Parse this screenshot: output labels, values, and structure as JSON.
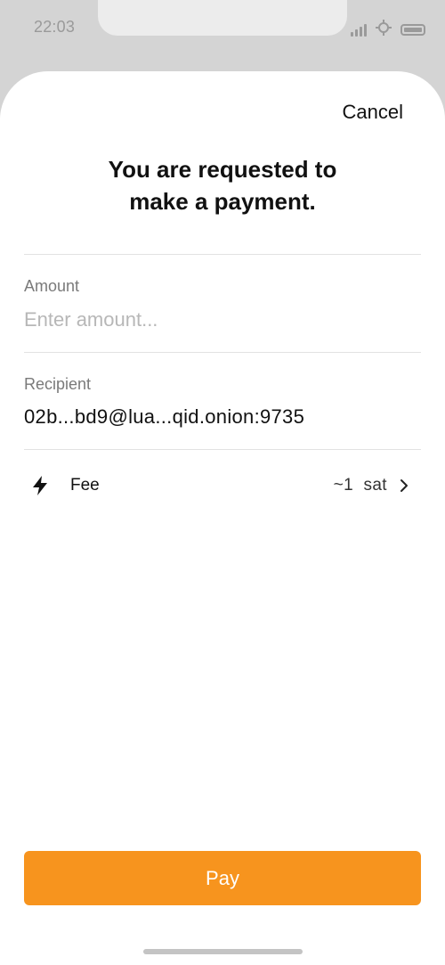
{
  "status_bar": {
    "time": "22:03"
  },
  "header": {
    "cancel_label": "Cancel",
    "title_line1": "You are requested to",
    "title_line2": "make a payment."
  },
  "amount": {
    "label": "Amount",
    "placeholder": "Enter amount...",
    "value": ""
  },
  "recipient": {
    "label": "Recipient",
    "value": "02b...bd9@lua...qid.onion:9735"
  },
  "fee": {
    "icon": "lightning-bolt-icon",
    "label": "Fee",
    "value": "~1  sat"
  },
  "pay_button": {
    "label": "Pay"
  },
  "colors": {
    "accent": "#f7941e",
    "chrome": "#d4d4d4",
    "muted_text": "#7a7a7a",
    "placeholder": "#b7b7b7"
  }
}
